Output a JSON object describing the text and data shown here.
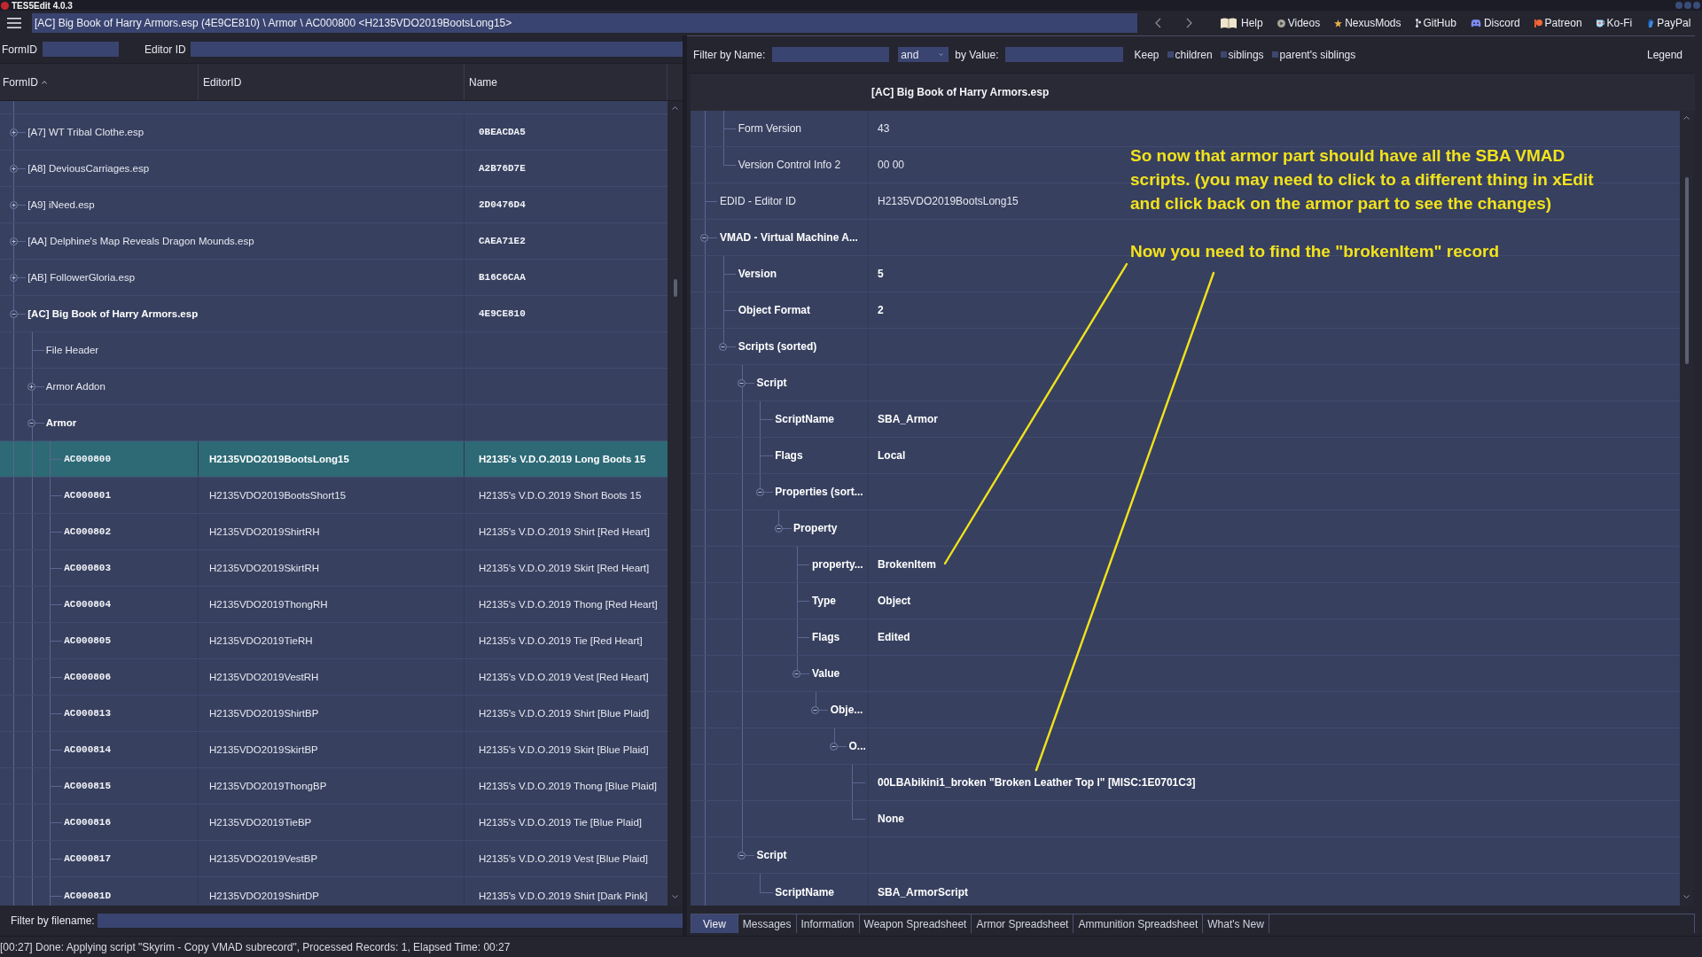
{
  "window": {
    "title": "TES5Edit 4.0.3"
  },
  "toolbar": {
    "path": "[AC] Big Book of Harry Armors.esp (4E9CE810) \\ Armor \\ AC000800 <H2135VDO2019BootsLong15>",
    "links": [
      {
        "label": "Help",
        "kind": "book"
      },
      {
        "label": "Videos",
        "kind": "play"
      },
      {
        "label": "NexusMods",
        "kind": "star"
      },
      {
        "label": "GitHub",
        "kind": "branch"
      },
      {
        "label": "Discord",
        "kind": "gamepad"
      },
      {
        "label": "Patreon",
        "kind": "circle"
      },
      {
        "label": "Ko-Fi",
        "kind": "cup"
      },
      {
        "label": "PayPal",
        "kind": "slant"
      }
    ]
  },
  "search": {
    "form_id_label": "FormID",
    "editor_id_label": "Editor ID"
  },
  "navigator": {
    "columns": [
      {
        "label": "FormID",
        "sorted": true
      },
      {
        "label": "EditorID",
        "sorted": false
      },
      {
        "label": "Name",
        "sorted": false
      }
    ],
    "tree": [
      {
        "kind": "file",
        "label": "[A7] WT Tribal Clothe.esp",
        "name": "0BEACDA5",
        "expanded": false
      },
      {
        "kind": "file",
        "label": "[A8] DeviousCarriages.esp",
        "name": "A2B76D7E",
        "expanded": false
      },
      {
        "kind": "file",
        "label": "[A9] iNeed.esp",
        "name": "2D0476D4",
        "expanded": false
      },
      {
        "kind": "file",
        "label": "[AA] Delphine's Map Reveals Dragon Mounds.esp",
        "name": "CAEA71E2",
        "expanded": false
      },
      {
        "kind": "file",
        "label": "[AB] FollowerGloria.esp",
        "name": "B16C6CAA",
        "expanded": false
      },
      {
        "kind": "file",
        "label": "[AC] Big Book of Harry Armors.esp",
        "name": "4E9CE810",
        "expanded": true,
        "children": [
          {
            "kind": "group",
            "label": "File Header"
          },
          {
            "kind": "group",
            "label": "Armor Addon",
            "expanded": false
          },
          {
            "kind": "group",
            "label": "Armor",
            "expanded": true,
            "children": [
              {
                "kind": "record",
                "form_id": "AC000800",
                "editor_id": "H2135VDO2019BootsLong15",
                "name": "H2135's V.D.O.2019 Long Boots 15",
                "selected": true
              },
              {
                "kind": "record",
                "form_id": "AC000801",
                "editor_id": "H2135VDO2019BootsShort15",
                "name": "H2135's V.D.O.2019 Short Boots 15",
                "selected": false
              },
              {
                "kind": "record",
                "form_id": "AC000802",
                "editor_id": "H2135VDO2019ShirtRH",
                "name": "H2135's V.D.O.2019 Shirt [Red Heart]",
                "selected": false
              },
              {
                "kind": "record",
                "form_id": "AC000803",
                "editor_id": "H2135VDO2019SkirtRH",
                "name": "H2135's V.D.O.2019 Skirt [Red Heart]",
                "selected": false
              },
              {
                "kind": "record",
                "form_id": "AC000804",
                "editor_id": "H2135VDO2019ThongRH",
                "name": "H2135's V.D.O.2019 Thong [Red Heart]",
                "selected": false
              },
              {
                "kind": "record",
                "form_id": "AC000805",
                "editor_id": "H2135VDO2019TieRH",
                "name": "H2135's V.D.O.2019 Tie [Red Heart]",
                "selected": false
              },
              {
                "kind": "record",
                "form_id": "AC000806",
                "editor_id": "H2135VDO2019VestRH",
                "name": "H2135's V.D.O.2019 Vest [Red Heart]",
                "selected": false
              },
              {
                "kind": "record",
                "form_id": "AC000813",
                "editor_id": "H2135VDO2019ShirtBP",
                "name": "H2135's V.D.O.2019 Shirt [Blue Plaid]",
                "selected": false
              },
              {
                "kind": "record",
                "form_id": "AC000814",
                "editor_id": "H2135VDO2019SkirtBP",
                "name": "H2135's V.D.O.2019 Skirt [Blue Plaid]",
                "selected": false
              },
              {
                "kind": "record",
                "form_id": "AC000815",
                "editor_id": "H2135VDO2019ThongBP",
                "name": "H2135's V.D.O.2019 Thong [Blue Plaid]",
                "selected": false
              },
              {
                "kind": "record",
                "form_id": "AC000816",
                "editor_id": "H2135VDO2019TieBP",
                "name": "H2135's V.D.O.2019 Tie [Blue Plaid]",
                "selected": false
              },
              {
                "kind": "record",
                "form_id": "AC000817",
                "editor_id": "H2135VDO2019VestBP",
                "name": "H2135's V.D.O.2019 Vest [Blue Plaid]",
                "selected": false
              },
              {
                "kind": "record",
                "form_id": "AC00081D",
                "editor_id": "H2135VDO2019ShirtDP",
                "name": "H2135's V.D.O.2019 Shirt [Dark Pink]",
                "selected": false
              }
            ]
          }
        ]
      }
    ],
    "filter_label": "Filter by filename:"
  },
  "filter": {
    "name_label": "Filter by Name:",
    "operator": "and",
    "value_label": "by Value:",
    "keep_label": "Keep",
    "keep_options": [
      {
        "label": "children",
        "checked": false
      },
      {
        "label": "siblings",
        "checked": false
      },
      {
        "label": "parent's siblings",
        "checked": false
      }
    ],
    "legend": "Legend"
  },
  "view": {
    "header": "[AC] Big Book of Harry Armors.esp",
    "rows": [
      {
        "children": [
          {
            "label": "Form Version",
            "value": "43",
            "bold": false
          },
          {
            "label": "Version Control Info 2",
            "value": "00 00",
            "bold": false
          }
        ]
      },
      {
        "label": "EDID - Editor ID",
        "value": "H2135VDO2019BootsLong15",
        "bold": false
      },
      {
        "label": "VMAD - Virtual Machine A...",
        "bold": true,
        "expanded": true,
        "children": [
          {
            "label": "Version",
            "value": "5",
            "bold": true
          },
          {
            "label": "Object Format",
            "value": "2",
            "bold": true
          },
          {
            "label": "Scripts (sorted)",
            "bold": true,
            "expanded": true,
            "children": [
              {
                "label": "Script",
                "bold": true,
                "expanded": true,
                "children": [
                  {
                    "label": "ScriptName",
                    "value": "SBA_Armor",
                    "bold": true
                  },
                  {
                    "label": "Flags",
                    "value": "Local",
                    "bold": true
                  },
                  {
                    "label": "Properties (sort...",
                    "bold": true,
                    "expanded": true,
                    "children": [
                      {
                        "label": "Property",
                        "bold": true,
                        "expanded": true,
                        "children": [
                          {
                            "label": "property...",
                            "value": "BrokenItem",
                            "bold": true
                          },
                          {
                            "label": "Type",
                            "value": "Object",
                            "bold": true
                          },
                          {
                            "label": "Flags",
                            "value": "Edited",
                            "bold": true
                          },
                          {
                            "label": "Value",
                            "bold": true,
                            "expanded": true,
                            "children": [
                              {
                                "label": "Obje...",
                                "bold": true,
                                "expanded": true,
                                "children": [
                                  {
                                    "label": "O...",
                                    "bold": true,
                                    "expanded": true,
                                    "children": [
                                      {
                                        "value": "00LBAbikini1_broken \"Broken Leather Top I\" [MISC:1E0701C3]",
                                        "bold": true
                                      },
                                      {
                                        "value": "None",
                                        "bold": true
                                      }
                                    ]
                                  }
                                ]
                              }
                            ]
                          }
                        ]
                      }
                    ]
                  }
                ]
              },
              {
                "label": "Script",
                "bold": true,
                "expanded": true,
                "children": [
                  {
                    "label": "ScriptName",
                    "value": "SBA_ArmorScript",
                    "bold": true
                  }
                ]
              }
            ]
          }
        ]
      }
    ]
  },
  "tabs": [
    {
      "label": "View",
      "selected": true
    },
    {
      "label": "Messages",
      "selected": false
    },
    {
      "label": "Information",
      "selected": false
    },
    {
      "label": "Weapon Spreadsheet",
      "selected": false
    },
    {
      "label": "Armor Spreadsheet",
      "selected": false
    },
    {
      "label": "Ammunition Spreadsheet",
      "selected": false
    },
    {
      "label": "What's New",
      "selected": false
    }
  ],
  "annotations": [
    "So now that armor part should have all the SBA VMAD scripts. (you may need to click to a different thing in xEdit and click back on the armor part to see the changes)",
    "Now you need to find the \"brokenItem\" record"
  ],
  "status_bar": "[00:27] Done: Applying script \"Skyrim - Copy VMAD subrecord\", Processed Records: 1, Elapsed Time: 00:27"
}
